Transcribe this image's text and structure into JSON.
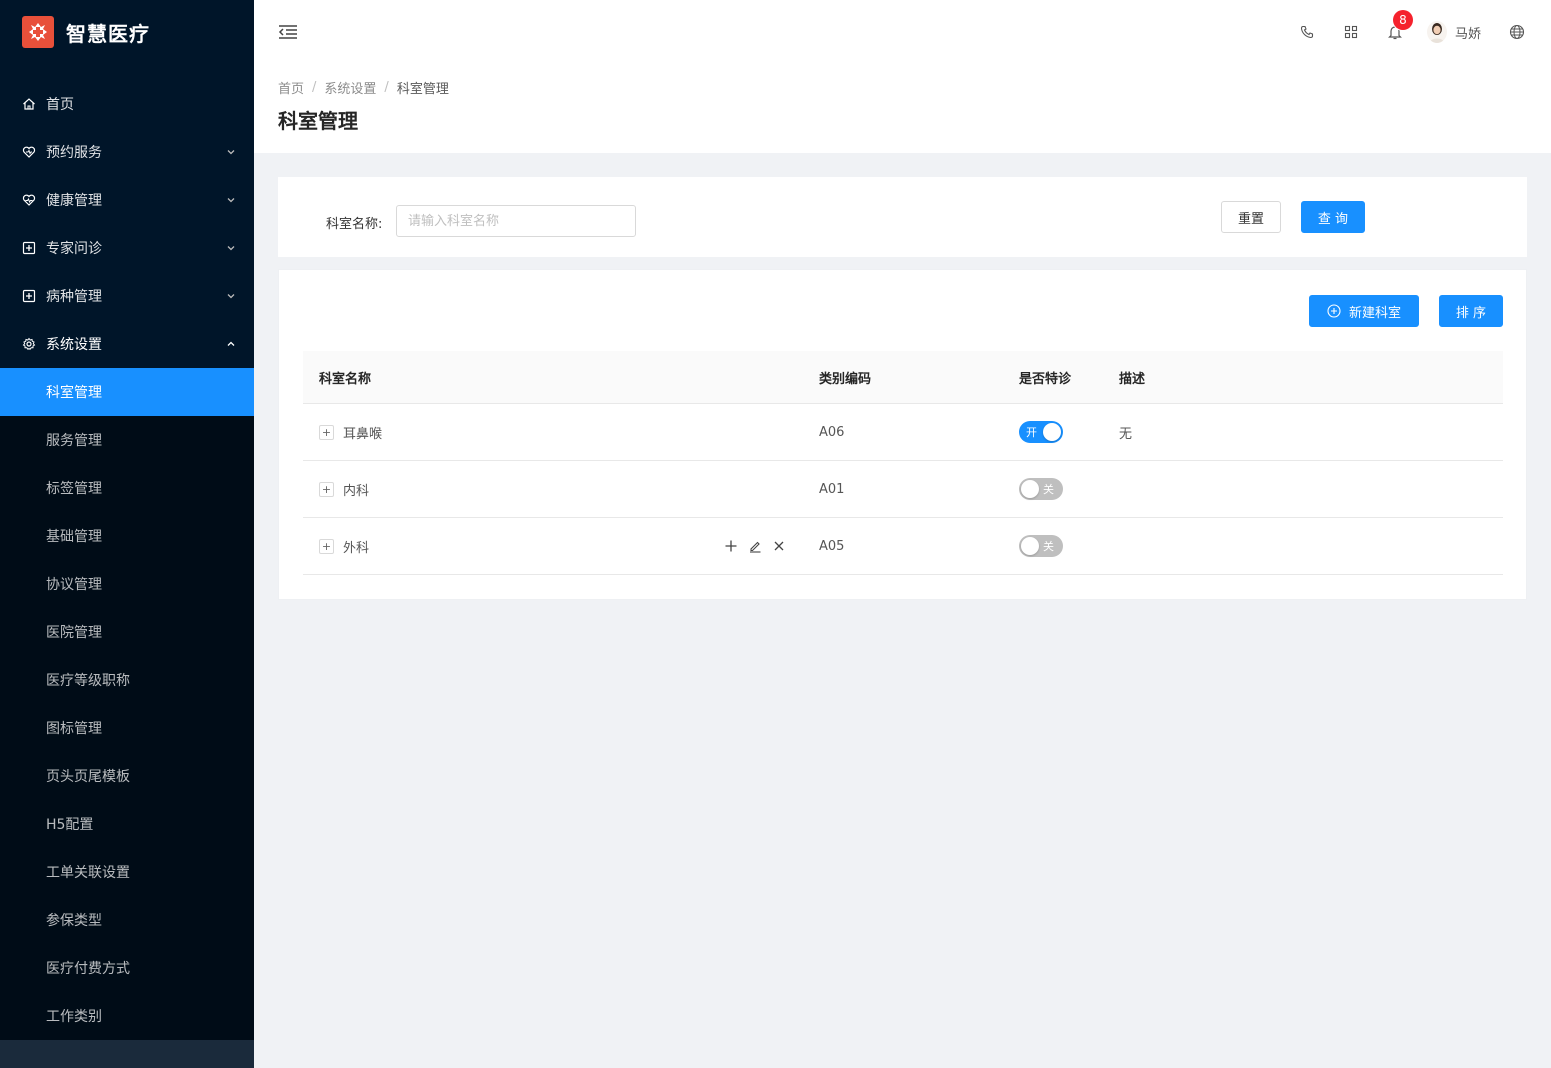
{
  "app": {
    "title": "智慧医疗"
  },
  "sidebar": {
    "items": [
      {
        "label": "首页",
        "icon": "home-icon"
      },
      {
        "label": "预约服务",
        "icon": "heart-icon"
      },
      {
        "label": "健康管理",
        "icon": "heart-pulse-icon"
      },
      {
        "label": "专家问诊",
        "icon": "medical-plus-icon"
      },
      {
        "label": "病种管理",
        "icon": "medical-plus-icon"
      },
      {
        "label": "系统设置",
        "icon": "gear-icon"
      }
    ],
    "sub_items": [
      {
        "label": "科室管理",
        "active": true
      },
      {
        "label": "服务管理"
      },
      {
        "label": "标签管理"
      },
      {
        "label": "基础管理"
      },
      {
        "label": "协议管理"
      },
      {
        "label": "医院管理"
      },
      {
        "label": "医疗等级职称"
      },
      {
        "label": "图标管理"
      },
      {
        "label": "页头页尾模板"
      },
      {
        "label": "H5配置"
      },
      {
        "label": "工单关联设置"
      },
      {
        "label": "参保类型"
      },
      {
        "label": "医疗付费方式"
      },
      {
        "label": "工作类别"
      }
    ]
  },
  "header": {
    "notification_count": "8",
    "user_name": "马娇"
  },
  "breadcrumb": [
    "首页",
    "系统设置",
    "科室管理"
  ],
  "page": {
    "title": "科室管理"
  },
  "search": {
    "label": "科室名称:",
    "placeholder": "请输入科室名称",
    "value": "",
    "reset_label": "重置",
    "query_label": "查 询"
  },
  "toolbar": {
    "new_label": "新建科室",
    "sort_label": "排 序"
  },
  "table": {
    "columns": [
      "科室名称",
      "类别编码",
      "是否特诊",
      "描述"
    ],
    "rows": [
      {
        "name": "耳鼻喉",
        "code": "A06",
        "special": true,
        "switch_text": "开",
        "desc": "无"
      },
      {
        "name": "内科",
        "code": "A01",
        "special": false,
        "switch_text": "关",
        "desc": ""
      },
      {
        "name": "外科",
        "code": "A05",
        "special": false,
        "switch_text": "关",
        "desc": ""
      }
    ]
  },
  "colors": {
    "sidebar_bg": "#001529",
    "primary": "#1890ff",
    "logo_bg": "#e8503a",
    "badge": "#f5222d"
  }
}
